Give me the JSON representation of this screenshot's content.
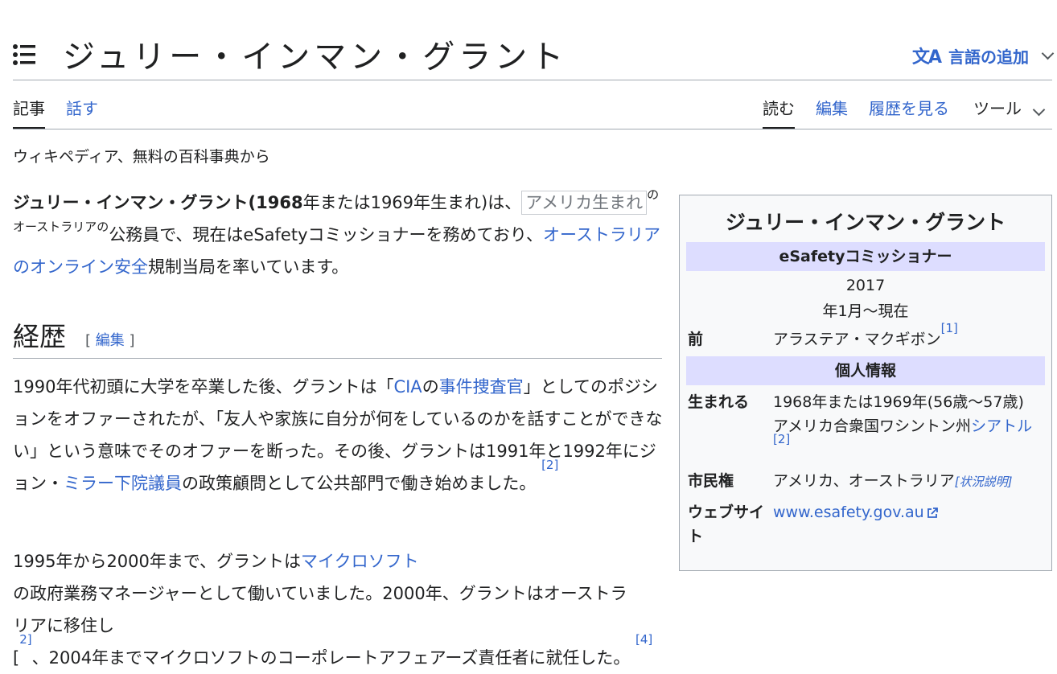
{
  "page": {
    "title": "ジュリー・インマン・グラント",
    "language_button": "言語の追加",
    "translate_icon": "文A"
  },
  "tabs": {
    "left": [
      "記事",
      "話す"
    ],
    "right": [
      "読む",
      "編集",
      "履歴を見る",
      "ツール"
    ]
  },
  "tagline": "ウィキペディア、無料の百科事典から",
  "intro": {
    "name_bold": "ジュリー・インマン・グラント",
    "paren_bold_open": "(1968",
    "paren_rest": "年または1969年生まれ)は、",
    "boxed": "アメリカ生まれ",
    "small": "のオーストラリアの",
    "text2": "公務員で、現在はeSafetyコミッショナーを務めており、",
    "link": "オーストラリアのオンライン安全",
    "text3": "規制当局を率いています。"
  },
  "section": {
    "heading": "経歴",
    "edit_open": "[",
    "edit_label": "編集",
    "edit_close": "]"
  },
  "para1": {
    "t1": "1990年代初頭に大学を卒業した後、グラントは「",
    "l1": "CIA",
    "t2": "の",
    "l2": "事件捜査官",
    "t3": "」としてのポジションをオファーされたが、「友人や家族に自分が何をしているのかを話すことができない」という意味でそのオファーを断った。その後、グラントは1991年と1992年にジョン・",
    "l3": "ミラー下院議員",
    "t4": "の政策顧問として公共部門で働き始めました。",
    "ref": "[2]"
  },
  "para2": {
    "t1": "1995年から2000年まで、グラントは",
    "l1": "マイクロソフト",
    "t2": "の政府業務マネージャーとして働いていました。2000年、グラントはオーストラリアに移住し",
    "t3": "[",
    "ref1": "2]",
    "t4": "、2004年までマイクロソフトのコーポレートアフェアーズ責任者に就任した。",
    "ref2": "[4]"
  },
  "infobox": {
    "title": "ジュリー・インマン・グラント",
    "office": "eSafetyコミッショナー",
    "term_line1": "2017",
    "term_line2": "年1月〜現在",
    "preceded_label": "前",
    "preceded_value": "アラステア・マクギボン",
    "preceded_ref": "[1]",
    "personal_header": "個人情報",
    "born_label": "生まれる",
    "born_line1": "1968年または1969年(56歳〜57歳)",
    "born_text": "アメリカ合衆国ワシントン州",
    "born_link": "シアトル",
    "born_ref": "[2]",
    "citizen_label": "市民権",
    "citizen_value": "アメリカ、オーストラリア",
    "citizen_note": "[状況説明]",
    "website_label": "ウェブサイト",
    "website_value": "www.esafety.gov.au"
  },
  "colors": {
    "link": "#3366cc",
    "infobox_header_bg": "#ddddff",
    "infobox_bg": "#f8f9fa",
    "text": "#202122"
  }
}
